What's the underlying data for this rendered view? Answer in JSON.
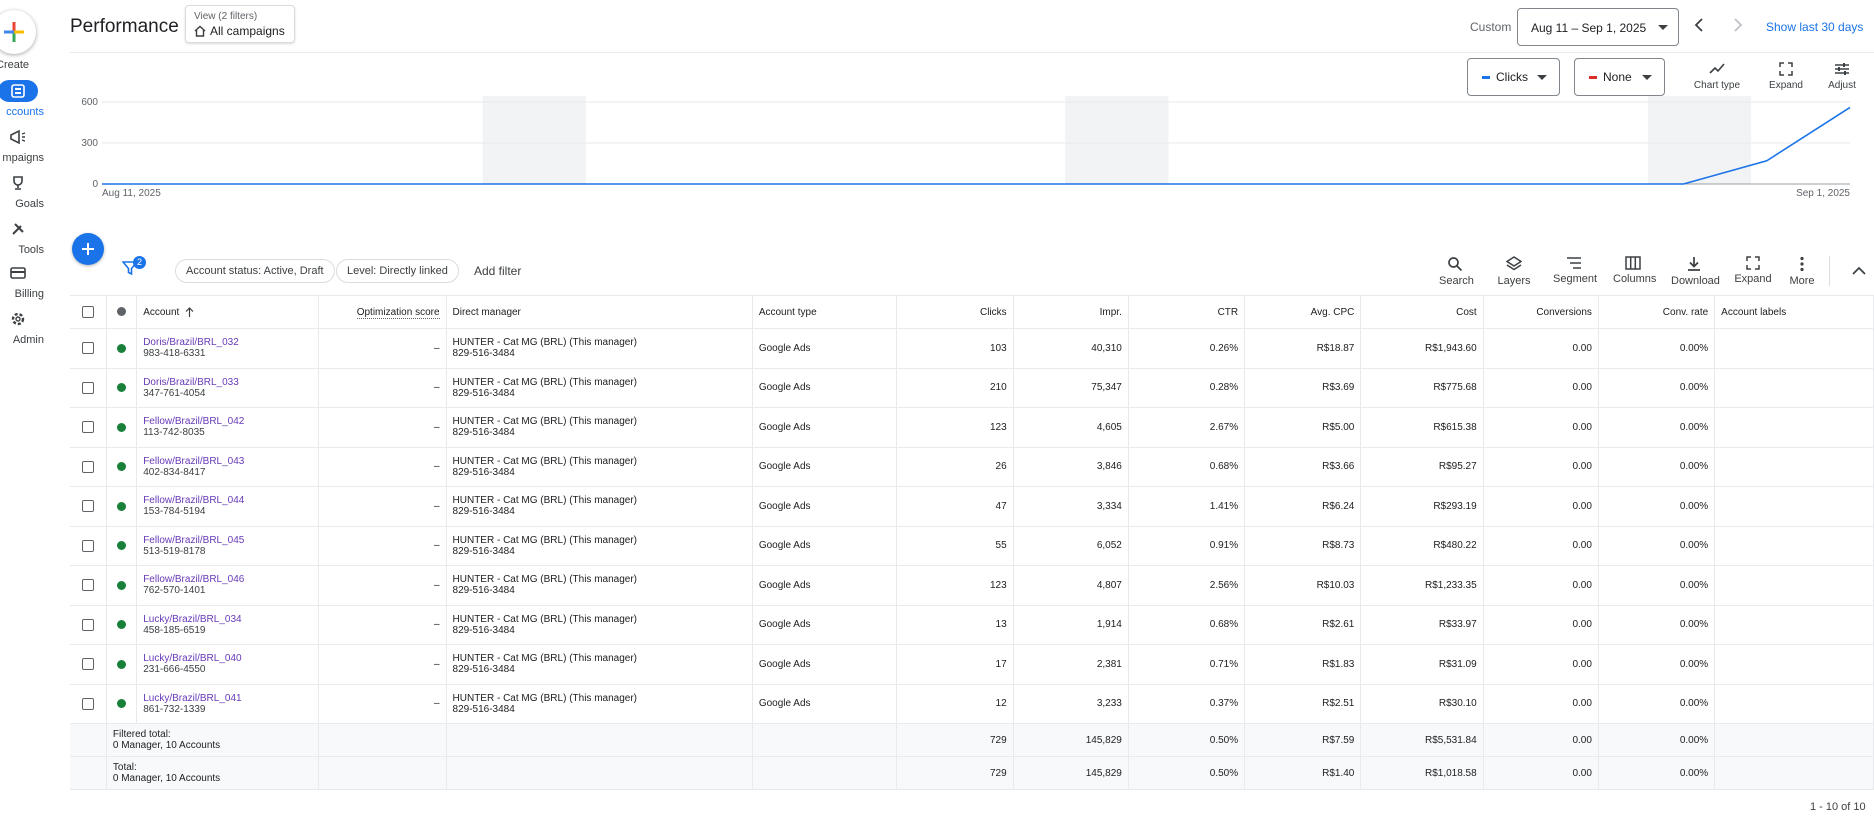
{
  "nav": {
    "create_label": "Create",
    "items": [
      {
        "label": "ccounts",
        "icon": "accounts-icon",
        "active": true
      },
      {
        "label": "mpaigns",
        "icon": "campaigns-icon",
        "active": false
      },
      {
        "label": "Goals",
        "icon": "goals-icon",
        "active": false
      },
      {
        "label": "Tools",
        "icon": "tools-icon",
        "active": false
      },
      {
        "label": "Billing",
        "icon": "billing-icon",
        "active": false
      },
      {
        "label": "Admin",
        "icon": "admin-icon",
        "active": false
      }
    ]
  },
  "header": {
    "title": "Performance",
    "view_line1": "View (2 filters)",
    "view_line2": "All campaigns",
    "custom_label": "Custom",
    "date_range": "Aug 11 – Sep 1, 2025",
    "show_last": "Show last 30 days"
  },
  "chart_toolbar": {
    "metric1": "Clicks",
    "metric1_color": "#1a73e8",
    "metric2": "None",
    "metric2_color": "#d93025",
    "chart_type": "Chart type",
    "expand": "Expand",
    "adjust": "Adjust"
  },
  "chart_data": {
    "type": "line",
    "x_start_label": "Aug 11, 2025",
    "x_end_label": "Sep 1, 2025",
    "y_ticks": [
      "600",
      "300",
      "0"
    ],
    "ylim": [
      0,
      600
    ],
    "grid": true,
    "series": [
      {
        "color": "#1a73e8",
        "values": [
          0,
          0,
          0,
          0,
          0,
          0,
          0,
          0,
          0,
          0,
          0,
          0,
          0,
          0,
          0,
          0,
          0,
          0,
          0,
          0,
          170,
          560
        ]
      }
    ]
  },
  "filter_bar": {
    "badge": "2",
    "chip1": "Account status: Active, Draft",
    "chip2": "Level: Directly linked",
    "add_filter": "Add filter",
    "tools": {
      "search": "Search",
      "layers": "Layers",
      "segment": "Segment",
      "columns": "Columns",
      "download": "Download",
      "expand": "Expand",
      "more": "More"
    }
  },
  "table": {
    "headers": {
      "account": "Account",
      "opt": "Optimization score",
      "dm": "Direct manager",
      "type": "Account type",
      "clicks": "Clicks",
      "impr": "Impr.",
      "ctr": "CTR",
      "cpc": "Avg. CPC",
      "cost": "Cost",
      "conv": "Conversions",
      "convrate": "Conv. rate",
      "labels": "Account labels"
    },
    "rows": [
      {
        "name": "Doris/Brazil/BRL_032",
        "id": "983-418-6331",
        "opt": "–",
        "dm": "HUNTER - Cat MG (BRL) (This manager)",
        "dm_id": "829-516-3484",
        "type": "Google Ads",
        "clicks": "103",
        "impr": "40,310",
        "ctr": "0.26%",
        "cpc": "R$18.87",
        "cost": "R$1,943.60",
        "conv": "0.00",
        "convrate": "0.00%"
      },
      {
        "name": "Doris/Brazil/BRL_033",
        "id": "347-761-4054",
        "opt": "–",
        "dm": "HUNTER - Cat MG (BRL) (This manager)",
        "dm_id": "829-516-3484",
        "type": "Google Ads",
        "clicks": "210",
        "impr": "75,347",
        "ctr": "0.28%",
        "cpc": "R$3.69",
        "cost": "R$775.68",
        "conv": "0.00",
        "convrate": "0.00%"
      },
      {
        "name": "Fellow/Brazil/BRL_042",
        "id": "113-742-8035",
        "opt": "–",
        "dm": "HUNTER - Cat MG (BRL) (This manager)",
        "dm_id": "829-516-3484",
        "type": "Google Ads",
        "clicks": "123",
        "impr": "4,605",
        "ctr": "2.67%",
        "cpc": "R$5.00",
        "cost": "R$615.38",
        "conv": "0.00",
        "convrate": "0.00%"
      },
      {
        "name": "Fellow/Brazil/BRL_043",
        "id": "402-834-8417",
        "opt": "–",
        "dm": "HUNTER - Cat MG (BRL) (This manager)",
        "dm_id": "829-516-3484",
        "type": "Google Ads",
        "clicks": "26",
        "impr": "3,846",
        "ctr": "0.68%",
        "cpc": "R$3.66",
        "cost": "R$95.27",
        "conv": "0.00",
        "convrate": "0.00%"
      },
      {
        "name": "Fellow/Brazil/BRL_044",
        "id": "153-784-5194",
        "opt": "–",
        "dm": "HUNTER - Cat MG (BRL) (This manager)",
        "dm_id": "829-516-3484",
        "type": "Google Ads",
        "clicks": "47",
        "impr": "3,334",
        "ctr": "1.41%",
        "cpc": "R$6.24",
        "cost": "R$293.19",
        "conv": "0.00",
        "convrate": "0.00%"
      },
      {
        "name": "Fellow/Brazil/BRL_045",
        "id": "513-519-8178",
        "opt": "–",
        "dm": "HUNTER - Cat MG (BRL) (This manager)",
        "dm_id": "829-516-3484",
        "type": "Google Ads",
        "clicks": "55",
        "impr": "6,052",
        "ctr": "0.91%",
        "cpc": "R$8.73",
        "cost": "R$480.22",
        "conv": "0.00",
        "convrate": "0.00%"
      },
      {
        "name": "Fellow/Brazil/BRL_046",
        "id": "762-570-1401",
        "opt": "–",
        "dm": "HUNTER - Cat MG (BRL) (This manager)",
        "dm_id": "829-516-3484",
        "type": "Google Ads",
        "clicks": "123",
        "impr": "4,807",
        "ctr": "2.56%",
        "cpc": "R$10.03",
        "cost": "R$1,233.35",
        "conv": "0.00",
        "convrate": "0.00%"
      },
      {
        "name": "Lucky/Brazil/BRL_034",
        "id": "458-185-6519",
        "opt": "–",
        "dm": "HUNTER - Cat MG (BRL) (This manager)",
        "dm_id": "829-516-3484",
        "type": "Google Ads",
        "clicks": "13",
        "impr": "1,914",
        "ctr": "0.68%",
        "cpc": "R$2.61",
        "cost": "R$33.97",
        "conv": "0.00",
        "convrate": "0.00%"
      },
      {
        "name": "Lucky/Brazil/BRL_040",
        "id": "231-666-4550",
        "opt": "–",
        "dm": "HUNTER - Cat MG (BRL) (This manager)",
        "dm_id": "829-516-3484",
        "type": "Google Ads",
        "clicks": "17",
        "impr": "2,381",
        "ctr": "0.71%",
        "cpc": "R$1.83",
        "cost": "R$31.09",
        "conv": "0.00",
        "convrate": "0.00%"
      },
      {
        "name": "Lucky/Brazil/BRL_041",
        "id": "861-732-1339",
        "opt": "–",
        "dm": "HUNTER - Cat MG (BRL) (This manager)",
        "dm_id": "829-516-3484",
        "type": "Google Ads",
        "clicks": "12",
        "impr": "3,233",
        "ctr": "0.37%",
        "cpc": "R$2.51",
        "cost": "R$30.10",
        "conv": "0.00",
        "convrate": "0.00%"
      }
    ],
    "filtered_total": {
      "label": "Filtered total:",
      "sub": "0 Manager, 10 Accounts",
      "clicks": "729",
      "impr": "145,829",
      "ctr": "0.50%",
      "cpc": "R$7.59",
      "cost": "R$5,531.84",
      "conv": "0.00",
      "convrate": "0.00%"
    },
    "total": {
      "label": "Total:",
      "sub": "0 Manager, 10 Accounts",
      "clicks": "729",
      "impr": "145,829",
      "ctr": "0.50%",
      "cpc": "R$1.40",
      "cost": "R$1,018.58",
      "conv": "0.00",
      "convrate": "0.00%"
    }
  },
  "pager": "1 - 10 of 10"
}
